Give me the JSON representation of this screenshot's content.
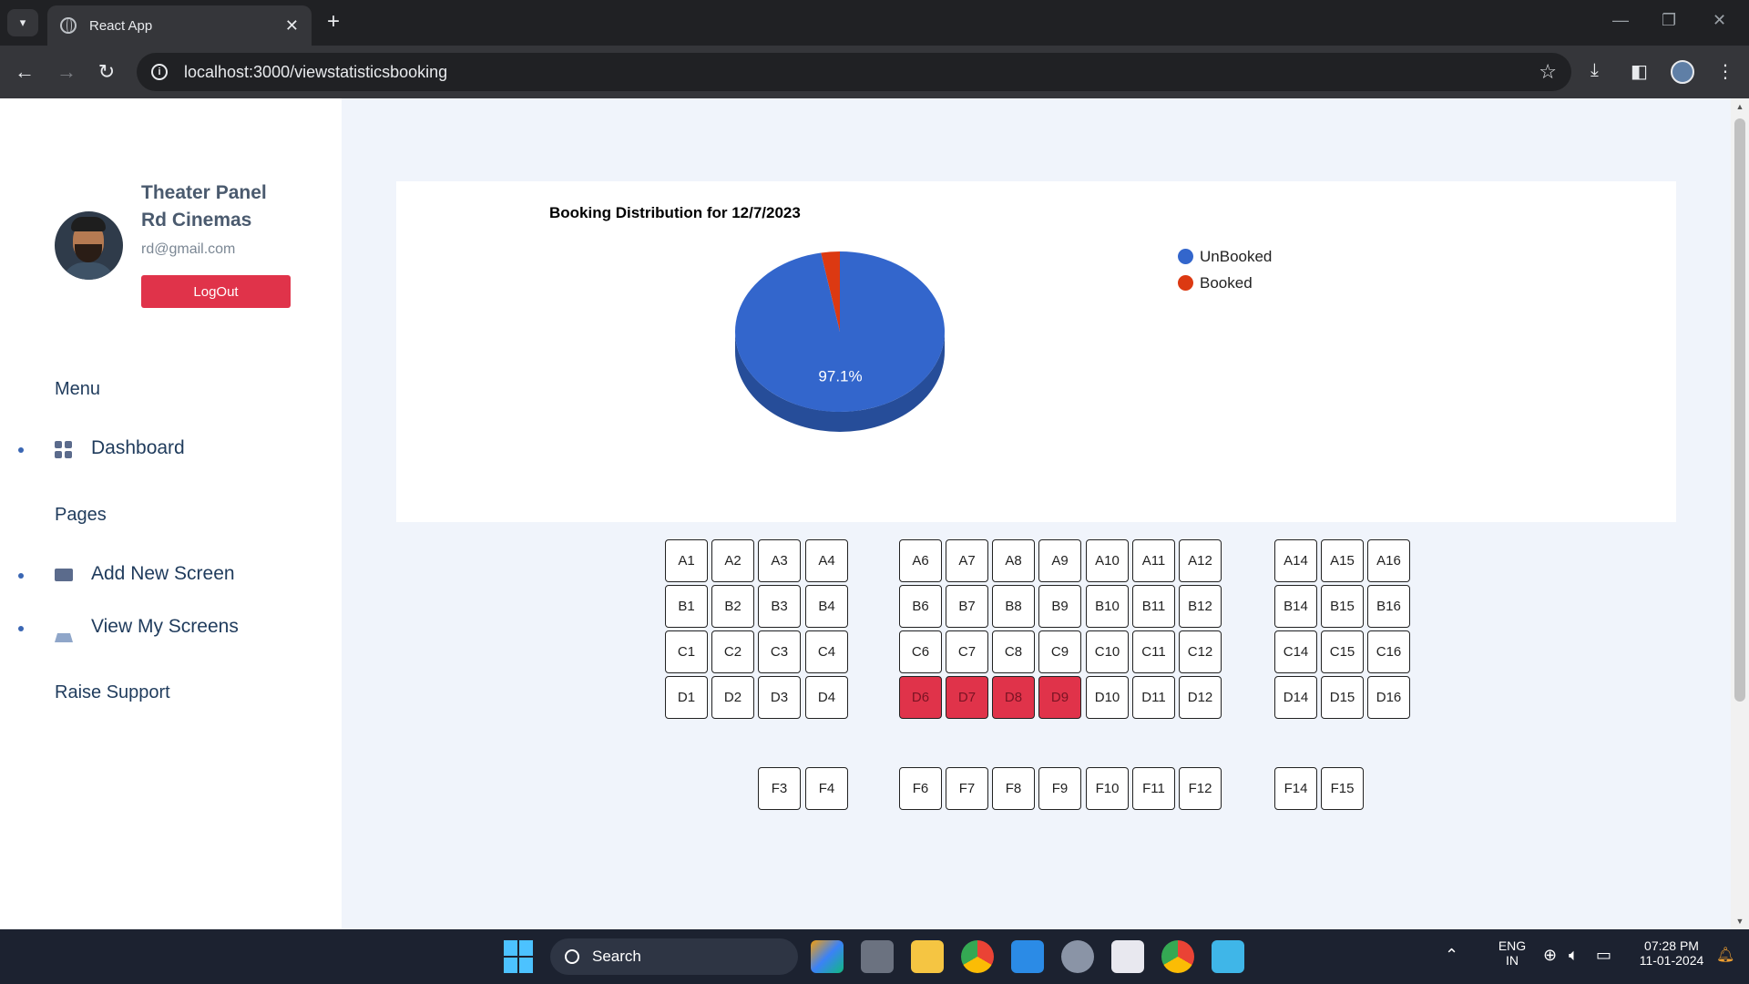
{
  "browser": {
    "tab_title": "React App",
    "url": "localhost:3000/viewstatisticsbooking"
  },
  "sidebar": {
    "panel_title": "Theater Panel",
    "theater_name": "Rd Cinemas",
    "email": "rd@gmail.com",
    "logout_label": "LogOut",
    "menu_heading": "Menu",
    "menu_items": [
      {
        "label": "Dashboard",
        "icon": "dashboard-grid-icon"
      }
    ],
    "pages_heading": "Pages",
    "page_items": [
      {
        "label": "Add New Screen",
        "icon": "envelope-icon"
      },
      {
        "label": "View My Screens",
        "icon": "basket-icon"
      }
    ],
    "support_label": "Raise Support"
  },
  "chart_data": {
    "type": "pie",
    "title": "Booking Distribution for 12/7/2023",
    "labels": [
      "UnBooked",
      "Booked"
    ],
    "values": [
      97.1,
      2.9
    ],
    "colors": [
      "#3366cc",
      "#dc3912"
    ],
    "data_labels": [
      "97.1%",
      ""
    ],
    "legend_position": "right",
    "style": "3d"
  },
  "seating": {
    "rows": [
      {
        "seats": [
          "A1",
          "A2",
          "A3",
          "A4",
          "A6",
          "A7",
          "A8",
          "A9",
          "A10",
          "A11",
          "A12",
          "A14",
          "A15",
          "A16"
        ]
      },
      {
        "seats": [
          "B1",
          "B2",
          "B3",
          "B4",
          "B6",
          "B7",
          "B8",
          "B9",
          "B10",
          "B11",
          "B12",
          "B14",
          "B15",
          "B16"
        ]
      },
      {
        "seats": [
          "C1",
          "C2",
          "C3",
          "C4",
          "C6",
          "C7",
          "C8",
          "C9",
          "C10",
          "C11",
          "C12",
          "C14",
          "C15",
          "C16"
        ]
      },
      {
        "seats": [
          "D1",
          "D2",
          "D3",
          "D4",
          "D6",
          "D7",
          "D8",
          "D9",
          "D10",
          "D11",
          "D12",
          "D14",
          "D15",
          "D16"
        ]
      },
      {
        "seats": [
          "F3",
          "F4",
          "F6",
          "F7",
          "F8",
          "F9",
          "F10",
          "F11",
          "F12",
          "F14",
          "F15"
        ]
      }
    ],
    "booked": [
      "D6",
      "D7",
      "D8",
      "D9"
    ]
  },
  "taskbar": {
    "search_label": "Search",
    "language": "ENG",
    "region": "IN",
    "time": "07:28 PM",
    "date": "11-01-2024"
  }
}
